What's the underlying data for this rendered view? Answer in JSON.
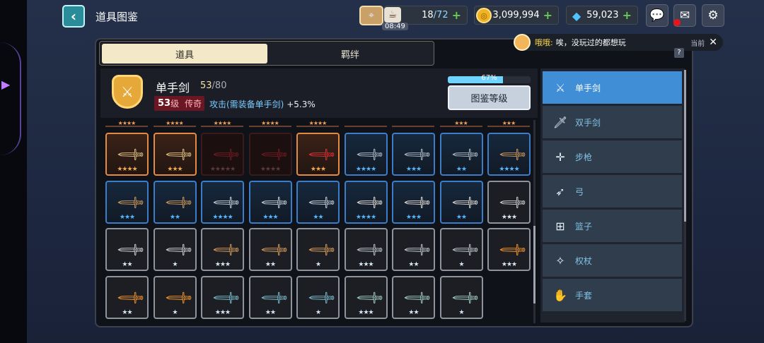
{
  "header": {
    "title": "道具图鉴",
    "stamina": "18",
    "stamina_max": "/72",
    "timer": "08:49",
    "gold": "3,099,994",
    "gems": "59,023"
  },
  "chat": {
    "name": "哦哦:",
    "message": "唉，没玩过的都想玩",
    "current": "当前"
  },
  "tabs": {
    "items": "道具",
    "bonds": "羁绊"
  },
  "item": {
    "name": "单手剑",
    "collected": "53",
    "total": "/80",
    "level": "53",
    "level_unit": "级",
    "rarity": "传奇",
    "bonus_label": "攻击(需装备单手剑)",
    "bonus_value": "+5.3%",
    "progress_text": "67%",
    "progress": 0.67,
    "grade_button": "图鉴等级"
  },
  "categories": [
    {
      "label": "单手剑",
      "icon": "one-hand-sword-icon",
      "glyph": "⚔"
    },
    {
      "label": "双手剑",
      "icon": "two-hand-sword-icon",
      "glyph": "🗡"
    },
    {
      "label": "步枪",
      "icon": "rifle-icon",
      "glyph": "✛"
    },
    {
      "label": "弓",
      "icon": "bow-icon",
      "glyph": "➶"
    },
    {
      "label": "篮子",
      "icon": "basket-icon",
      "glyph": "⊞"
    },
    {
      "label": "权杖",
      "icon": "staff-icon",
      "glyph": "✧"
    },
    {
      "label": "手套",
      "icon": "glove-icon",
      "glyph": "✋"
    }
  ],
  "peek_stars": [
    "★★★★",
    "★★★★",
    "★★★★",
    "★★★★",
    "★★★★",
    "",
    "",
    "★★★",
    "★★★"
  ],
  "grid": [
    [
      {
        "rarity": "orange",
        "stars": "★★★★",
        "sc": "s-orange",
        "wc": "#e8c98a"
      },
      {
        "rarity": "orange",
        "stars": "★★★",
        "sc": "s-orange",
        "wc": "#e8c98a"
      },
      {
        "rarity": "dark",
        "stars": "★★★★★",
        "sc": "s-dim",
        "wc": "#7a1c24"
      },
      {
        "rarity": "dark",
        "stars": "★★★★",
        "sc": "s-dim",
        "wc": "#7a1c24"
      },
      {
        "rarity": "orange",
        "stars": "★★★",
        "sc": "s-orange",
        "wc": "#e8313d"
      },
      {
        "rarity": "blue",
        "stars": "★★★★",
        "sc": "s-blue",
        "wc": "#b9c2cc"
      },
      {
        "rarity": "blue",
        "stars": "★★★",
        "sc": "s-blue",
        "wc": "#b9c2cc"
      },
      {
        "rarity": "blue",
        "stars": "★★",
        "sc": "s-blue",
        "wc": "#b9c2cc"
      },
      {
        "rarity": "blue",
        "stars": "★★★★",
        "sc": "s-blue",
        "wc": "#d9a05c"
      }
    ],
    [
      {
        "rarity": "blue",
        "stars": "★★★",
        "sc": "s-blue",
        "wc": "#d9a05c"
      },
      {
        "rarity": "blue",
        "stars": "★★",
        "sc": "s-blue",
        "wc": "#d9a05c"
      },
      {
        "rarity": "blue",
        "stars": "★★★★",
        "sc": "s-blue",
        "wc": "#cfd6de"
      },
      {
        "rarity": "blue",
        "stars": "★★★",
        "sc": "s-blue",
        "wc": "#cfd6de"
      },
      {
        "rarity": "blue",
        "stars": "★★",
        "sc": "s-blue",
        "wc": "#cfd6de"
      },
      {
        "rarity": "blue",
        "stars": "★★★★",
        "sc": "s-blue",
        "wc": "#e7e2d6"
      },
      {
        "rarity": "blue",
        "stars": "★★★",
        "sc": "s-blue",
        "wc": "#e7e2d6"
      },
      {
        "rarity": "blue",
        "stars": "★★",
        "sc": "s-blue",
        "wc": "#e7e2d6"
      },
      {
        "rarity": "gray",
        "stars": "★★★",
        "sc": "s-white",
        "wc": "#d6d9de"
      }
    ],
    [
      {
        "rarity": "gray",
        "stars": "★★",
        "sc": "s-white",
        "wc": "#d6d9de"
      },
      {
        "rarity": "gray",
        "stars": "★",
        "sc": "s-white",
        "wc": "#d6d9de"
      },
      {
        "rarity": "gray",
        "stars": "★★★",
        "sc": "s-white",
        "wc": "#e0a25c"
      },
      {
        "rarity": "gray",
        "stars": "★★",
        "sc": "s-white",
        "wc": "#e0a25c"
      },
      {
        "rarity": "gray",
        "stars": "★",
        "sc": "s-white",
        "wc": "#e0a25c"
      },
      {
        "rarity": "gray",
        "stars": "★★★",
        "sc": "s-white",
        "wc": "#c6ccd4"
      },
      {
        "rarity": "gray",
        "stars": "★★",
        "sc": "s-white",
        "wc": "#c6ccd4"
      },
      {
        "rarity": "gray",
        "stars": "★",
        "sc": "s-white",
        "wc": "#c6ccd4"
      },
      {
        "rarity": "gray",
        "stars": "★★★",
        "sc": "s-white",
        "wc": "#ff9a2a"
      }
    ],
    [
      {
        "rarity": "gray",
        "stars": "★★",
        "sc": "s-white",
        "wc": "#ff9a2a"
      },
      {
        "rarity": "gray",
        "stars": "★",
        "sc": "s-white",
        "wc": "#ff9a2a"
      },
      {
        "rarity": "gray",
        "stars": "★★★",
        "sc": "s-white",
        "wc": "#7fc5d8"
      },
      {
        "rarity": "gray",
        "stars": "★★",
        "sc": "s-white",
        "wc": "#7fc5d8"
      },
      {
        "rarity": "gray",
        "stars": "★",
        "sc": "s-white",
        "wc": "#7fc5d8"
      },
      {
        "rarity": "gray",
        "stars": "★★★",
        "sc": "s-white",
        "wc": "#a9d6cc"
      },
      {
        "rarity": "gray",
        "stars": "★★",
        "sc": "s-white",
        "wc": "#a9d6cc"
      },
      {
        "rarity": "gray",
        "stars": "★",
        "sc": "s-white",
        "wc": "#a9d6cc"
      }
    ]
  ]
}
